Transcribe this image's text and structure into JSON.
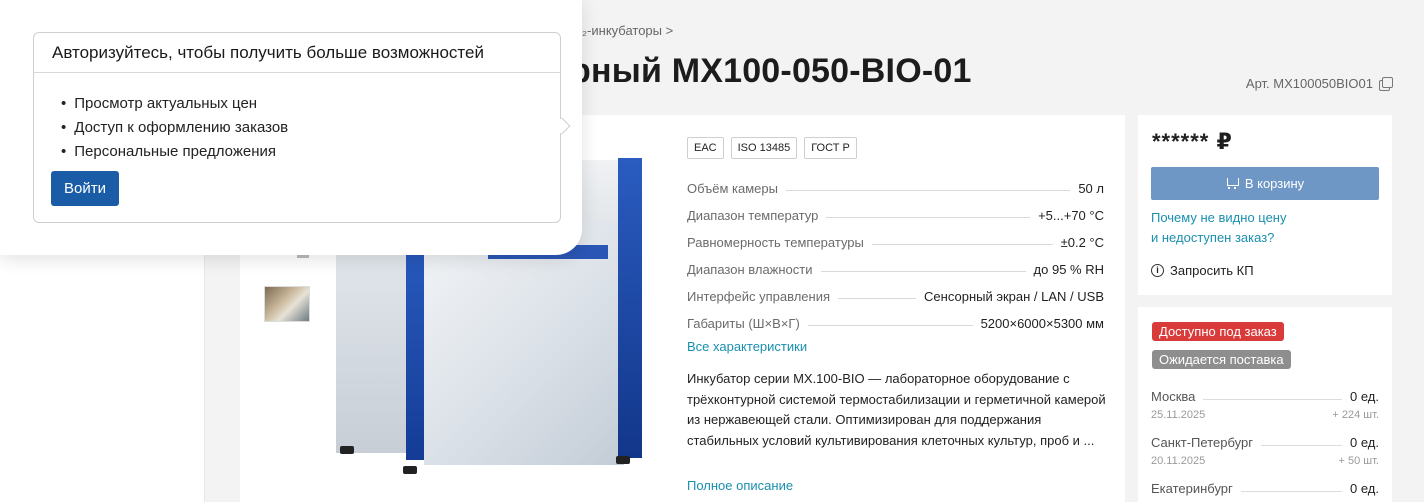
{
  "breadcrumb": {
    "tail": "₂-инкубаторы  >"
  },
  "product": {
    "title_visible": "рный MX100-050-BIO-01",
    "article": "Арт. MX100050BIO01",
    "certificates": [
      "EAC",
      "ISO 13485",
      "ГОСТ Р"
    ],
    "specs": [
      {
        "label": "Объём камеры",
        "value": "50 л"
      },
      {
        "label": "Диапазон температур",
        "value": "+5...+70 °C"
      },
      {
        "label": "Равномерность температуры",
        "value": "±0.2 °C"
      },
      {
        "label": "Диапазон влажности",
        "value": "до 95 % RH"
      },
      {
        "label": "Интерфейс управления",
        "value": "Сенсорный экран / LAN / USB"
      },
      {
        "label": "Габариты (Ш×В×Г)",
        "value": "5200×6000×5300 мм"
      }
    ],
    "all_specs_link": "Все характеристики",
    "description": "Инкубатор серии MX.100-BIO — лабораторное оборудование с трёхконтурной системой термостабилизации и герметичной камерой из нержавеющей стали. Оптимизирован для поддержания стабильных условий культивирования клеточных культур, проб и ...",
    "full_description_link": "Полное описание"
  },
  "purchase": {
    "price": "****** ₽",
    "cart_button": "В корзину",
    "why_link_line1": "Почему не видно цену",
    "why_link_line2": "и недоступен заказ?",
    "request_quote": "Запросить КП"
  },
  "availability": {
    "badge_order": "Доступно под заказ",
    "badge_expected": "Ожидается поставка",
    "stock": [
      {
        "city": "Москва",
        "qty": "0 ед.",
        "date": "25.11.2025",
        "incoming": "+ 224 шт."
      },
      {
        "city": "Санкт-Петербург",
        "qty": "0 ед.",
        "date": "20.11.2025",
        "incoming": "+ 50 шт."
      },
      {
        "city": "Екатеринбург",
        "qty": "0 ед.",
        "date": "",
        "incoming": ""
      }
    ]
  },
  "auth_popup": {
    "title": "Авторизуйтесь, чтобы получить больше возможностей",
    "benefits": [
      "Просмотр актуальных цен",
      "Доступ к оформлению заказов",
      "Персональные предложения"
    ],
    "login_button": "Войти"
  },
  "colors": {
    "accent_link": "#1a8fb0",
    "cart_button": "#6e97c5",
    "login_button": "#1a5da6",
    "badge_red": "#d93a3a",
    "badge_gray": "#8e8e8e"
  }
}
